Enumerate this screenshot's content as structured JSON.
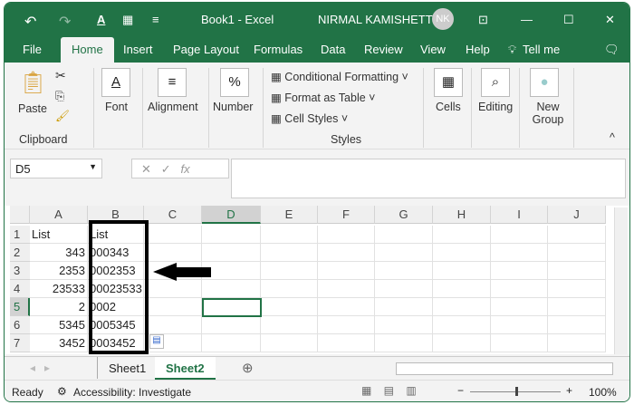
{
  "title_bar": {
    "doc_title": "Book1 - Excel",
    "user": "NIRMAL KAMISHETTY",
    "avatar": "NK"
  },
  "menu_tabs": [
    "File",
    "Home",
    "Insert",
    "Page Layout",
    "Formulas",
    "Data",
    "Review",
    "View",
    "Help",
    "Tell me"
  ],
  "ribbon": {
    "paste": "Paste",
    "clipboard": "Clipboard",
    "font": "Font",
    "alignment": "Alignment",
    "number": "Number",
    "conditional_formatting": "Conditional Formatting",
    "format_as_table": "Format as Table",
    "cell_styles": "Cell Styles",
    "styles": "Styles",
    "cells": "Cells",
    "editing": "Editing",
    "new_group": "New Group"
  },
  "formula_bar": {
    "name_box": "D5",
    "fx": "fx",
    "value": ""
  },
  "columns": [
    "A",
    "B",
    "C",
    "D",
    "E",
    "F",
    "G",
    "H",
    "I",
    "J"
  ],
  "rows": [
    {
      "n": "1",
      "a": "List",
      "b": "List"
    },
    {
      "n": "2",
      "a": "343",
      "b": "000343"
    },
    {
      "n": "3",
      "a": "2353",
      "b": "0002353"
    },
    {
      "n": "4",
      "a": "23533",
      "b": "00023533"
    },
    {
      "n": "5",
      "a": "2",
      "b": "0002"
    },
    {
      "n": "6",
      "a": "5345",
      "b": "0005345"
    },
    {
      "n": "7",
      "a": "3452",
      "b": "0003452"
    }
  ],
  "selected_cell": "D5",
  "sheets": [
    "Sheet1",
    "Sheet2"
  ],
  "active_sheet": "Sheet2",
  "status": {
    "ready": "Ready",
    "accessibility": "Accessibility: Investigate",
    "zoom": "100%"
  },
  "colors": {
    "accent": "#217346"
  }
}
